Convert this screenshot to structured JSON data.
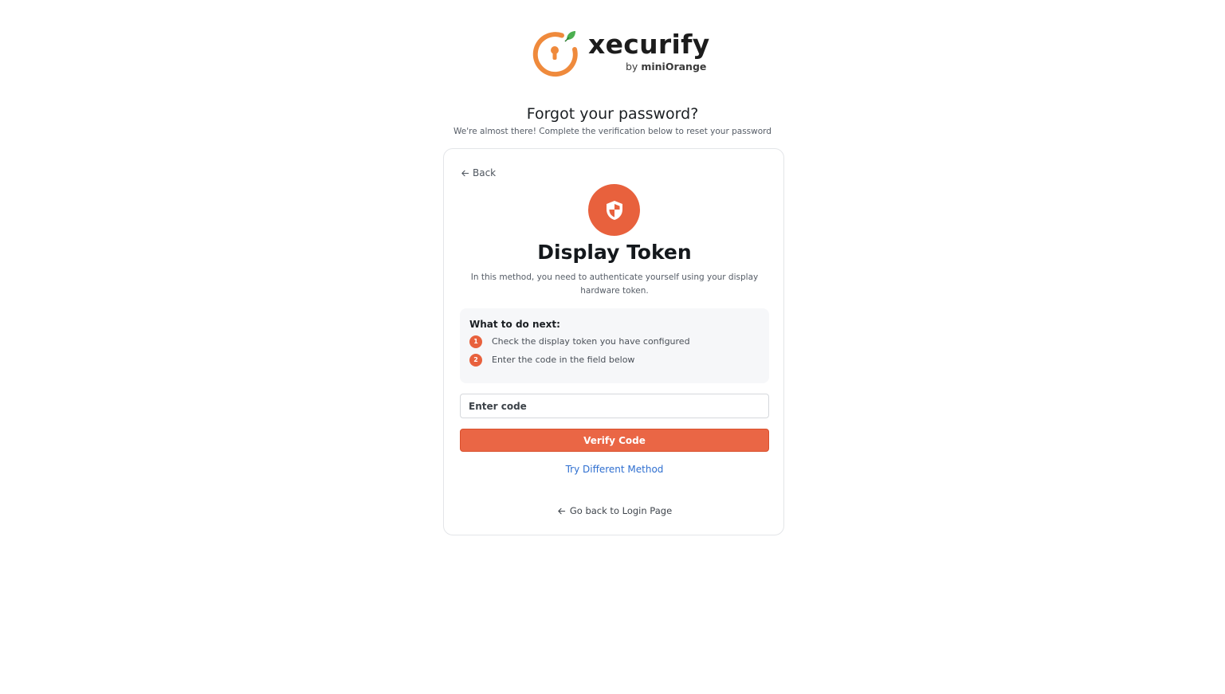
{
  "logo": {
    "name": "xecurify",
    "by_prefix": "by",
    "brand": "miniOrange",
    "accent_color": "#ef8a3c",
    "leaf_color": "#4caf50"
  },
  "header": {
    "title": "Forgot your password?",
    "subtitle": "We're almost there! Complete the verification below to reset your password"
  },
  "card": {
    "back_label": "Back",
    "icon": "shield-icon",
    "method_title": "Display Token",
    "method_description": "In this method, you need to authenticate yourself using your display hardware token.",
    "steps_heading": "What to do next:",
    "steps": [
      {
        "number": "1",
        "text": "Check the display token you have configured"
      },
      {
        "number": "2",
        "text": "Enter the code in the field below"
      }
    ],
    "code_input": {
      "placeholder": "Enter code",
      "value": ""
    },
    "verify_label": "Verify Code",
    "try_different_label": "Try Different Method",
    "go_back_label": "Go back to Login Page"
  },
  "colors": {
    "primary": "#ea6645",
    "link": "#2f6fd0"
  }
}
